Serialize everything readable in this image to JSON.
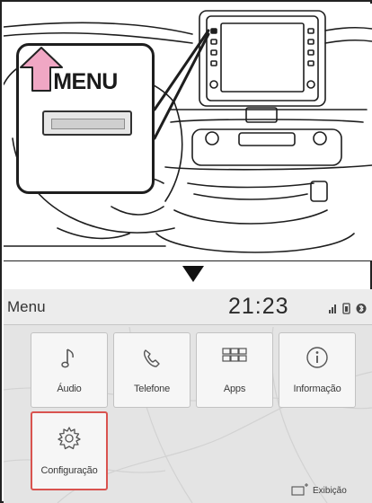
{
  "illustration": {
    "callout_label": "MENU"
  },
  "screen": {
    "title": "Menu",
    "clock": "21:23",
    "tiles": [
      {
        "label": "Áudio",
        "icon": "music-note-icon"
      },
      {
        "label": "Telefone",
        "icon": "phone-icon"
      },
      {
        "label": "Apps",
        "icon": "apps-grid-icon"
      },
      {
        "label": "Informação",
        "icon": "info-icon"
      },
      {
        "label": "Configuração",
        "icon": "settings-gear-icon",
        "highlighted": true
      }
    ],
    "display_button": {
      "label": "Exibição",
      "icon": "display-icon"
    },
    "status_icons": [
      "signal-icon",
      "battery-icon",
      "bluetooth-icon"
    ]
  },
  "colors": {
    "highlight": "#d9534f",
    "press_arrow": "#f0a7c4"
  }
}
